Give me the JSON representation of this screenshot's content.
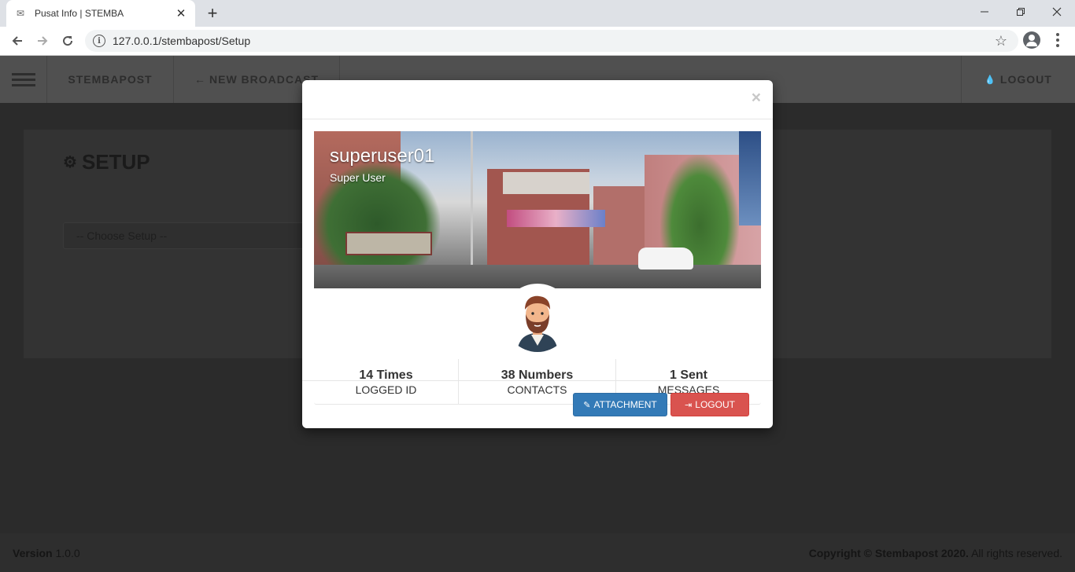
{
  "browser": {
    "tab_title": "Pusat Info | STEMBA",
    "url": "127.0.0.1/stembapost/Setup",
    "new_tab_icon": "plus-icon",
    "window_controls": [
      "minimize-icon",
      "maximize-icon",
      "close-icon"
    ]
  },
  "nav": {
    "brand": "STEMBAPOST",
    "new_broadcast": "NEW BROADCAST",
    "logout": "LOGOUT"
  },
  "page": {
    "title": "SETUP",
    "select_placeholder": "-- Choose Setup --"
  },
  "footer": {
    "version_label": "Version",
    "version_value": "1.0.0",
    "copyright_bold": "Copyright © Stembapost 2020.",
    "copyright_rest": "All rights reserved."
  },
  "modal": {
    "close_symbol": "×",
    "username": "superuser01",
    "role": "Super User",
    "stats": [
      {
        "value": "14 Times",
        "label": "LOGGED ID"
      },
      {
        "value": "38 Numbers",
        "label": "CONTACTS"
      },
      {
        "value": "1 Sent",
        "label": "MESSAGES"
      }
    ],
    "attachment_label": "ATTACHMENT",
    "logout_label": "LOGOUT"
  },
  "colors": {
    "primary": "#337ab7",
    "danger": "#d9534f",
    "overlay": "#2b2b2b"
  }
}
